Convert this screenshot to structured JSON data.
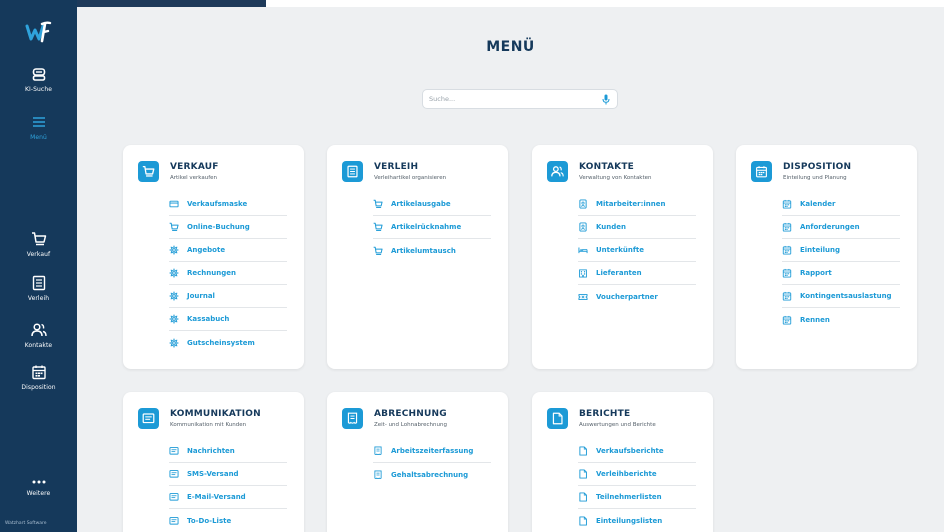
{
  "app": {
    "footer_brand": "Watzhart Software"
  },
  "sidebar": {
    "items": [
      {
        "id": "ki-suche",
        "label": "KI-Suche",
        "icon": "robot-icon"
      },
      {
        "id": "menu",
        "label": "Menü",
        "icon": "hamburger-menu-icon",
        "active": true
      },
      {
        "id": "verkauf",
        "label": "Verkauf",
        "icon": "cart-icon"
      },
      {
        "id": "verleih",
        "label": "Verleih",
        "icon": "document-icon"
      },
      {
        "id": "kontakte",
        "label": "Kontakte",
        "icon": "contacts-icon"
      },
      {
        "id": "disposition",
        "label": "Disposition",
        "icon": "calendar-icon"
      },
      {
        "id": "weitere",
        "label": "Weitere",
        "icon": "more-dots-icon"
      }
    ]
  },
  "main": {
    "title": "MENÜ",
    "search": {
      "placeholder": "Suche...",
      "value": ""
    }
  },
  "cards": {
    "verkauf": {
      "title": "VERKAUF",
      "subtitle": "Artikel verkaufen",
      "items": [
        "Verkaufsmaske",
        "Online-Buchung",
        "Angebote",
        "Rechnungen",
        "Journal",
        "Kassabuch",
        "Gutscheinsystem"
      ]
    },
    "verleih": {
      "title": "VERLEIH",
      "subtitle": "Verleihartikel organisieren",
      "items": [
        "Artikelausgabe",
        "Artikelrücknahme",
        "Artikelumtausch"
      ]
    },
    "kontakte": {
      "title": "KONTAKTE",
      "subtitle": "Verwaltung von Kontakten",
      "items": [
        "Mitarbeiter:innen",
        "Kunden",
        "Unterkünfte",
        "Lieferanten",
        "Voucherpartner"
      ]
    },
    "disposition": {
      "title": "DISPOSITION",
      "subtitle": "Einteilung und Planung",
      "items": [
        "Kalender",
        "Anforderungen",
        "Einteilung",
        "Rapport",
        "Kontingentsauslastung",
        "Rennen"
      ]
    },
    "kommunikation": {
      "title": "KOMMUNIKATION",
      "subtitle": "Kommunikation mit Kunden",
      "items": [
        "Nachrichten",
        "SMS-Versand",
        "E-Mail-Versand",
        "To-Do-Liste"
      ]
    },
    "abrechnung": {
      "title": "ABRECHNUNG",
      "subtitle": "Zeit- und Lohnabrechnung",
      "items": [
        "Arbeitszeiterfassung",
        "Gehaltsabrechnung"
      ]
    },
    "berichte": {
      "title": "BERICHTE",
      "subtitle": "Auswertungen und Berichte",
      "items": [
        "Verkaufsberichte",
        "Verleihberichte",
        "Teilnehmerlisten",
        "Einteilungslisten"
      ]
    }
  },
  "colors": {
    "sidebar": "#15395b",
    "accent": "#1c9ad6",
    "title": "#15395b",
    "background": "#eef0f2"
  }
}
